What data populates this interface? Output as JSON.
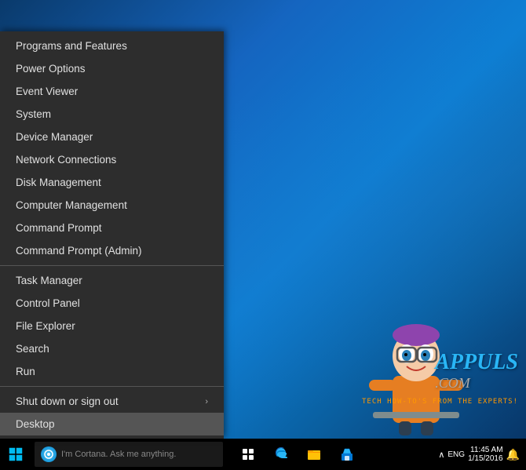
{
  "desktop": {
    "background": "Windows 10 desktop"
  },
  "contextMenu": {
    "items": [
      {
        "id": "programs-features",
        "label": "Programs and Features",
        "hasArrow": false,
        "active": false
      },
      {
        "id": "power-options",
        "label": "Power Options",
        "hasArrow": false,
        "active": false
      },
      {
        "id": "event-viewer",
        "label": "Event Viewer",
        "hasArrow": false,
        "active": false
      },
      {
        "id": "system",
        "label": "System",
        "hasArrow": false,
        "active": false
      },
      {
        "id": "device-manager",
        "label": "Device Manager",
        "hasArrow": false,
        "active": false
      },
      {
        "id": "network-connections",
        "label": "Network Connections",
        "hasArrow": false,
        "active": false
      },
      {
        "id": "disk-management",
        "label": "Disk Management",
        "hasArrow": false,
        "active": false
      },
      {
        "id": "computer-management",
        "label": "Computer Management",
        "hasArrow": false,
        "active": false
      },
      {
        "id": "command-prompt",
        "label": "Command Prompt",
        "hasArrow": false,
        "active": false
      },
      {
        "id": "command-prompt-admin",
        "label": "Command Prompt (Admin)",
        "hasArrow": false,
        "active": false
      },
      {
        "divider": true
      },
      {
        "id": "task-manager",
        "label": "Task Manager",
        "hasArrow": false,
        "active": false
      },
      {
        "id": "control-panel",
        "label": "Control Panel",
        "hasArrow": false,
        "active": false
      },
      {
        "id": "file-explorer",
        "label": "File Explorer",
        "hasArrow": false,
        "active": false
      },
      {
        "id": "search",
        "label": "Search",
        "hasArrow": false,
        "active": false
      },
      {
        "id": "run",
        "label": "Run",
        "hasArrow": false,
        "active": false
      },
      {
        "divider": true
      },
      {
        "id": "shut-down-sign-out",
        "label": "Shut down or sign out",
        "hasArrow": true,
        "active": false
      },
      {
        "id": "desktop",
        "label": "Desktop",
        "hasArrow": false,
        "active": true
      }
    ]
  },
  "taskbar": {
    "cortana_placeholder": "I'm Cortana. Ask me anything.",
    "start_label": "Start",
    "task_view_label": "Task View",
    "edge_label": "Microsoft Edge",
    "explorer_label": "File Explorer",
    "store_label": "Store"
  },
  "appuals": {
    "logo": "APPULS",
    "dot_com": ".COM",
    "tagline": "TECH HOW-TO'S FROM THE EXPERTS!"
  }
}
